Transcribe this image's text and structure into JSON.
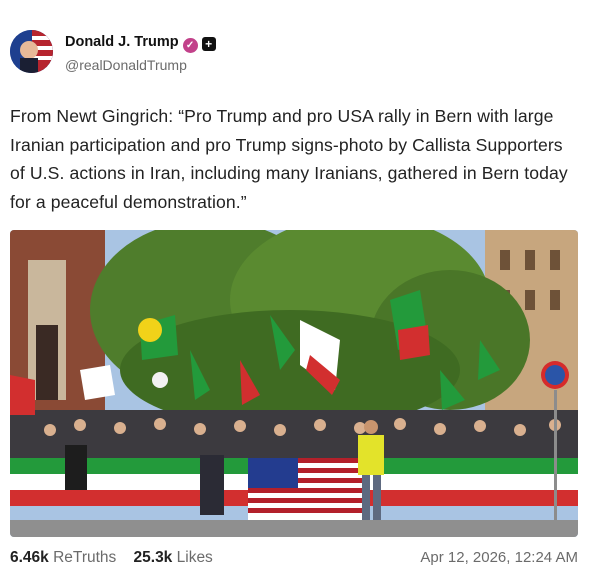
{
  "author": {
    "display_name": "Donald J. Trump",
    "handle": "@realDonaldTrump",
    "verified_icon": "verified-badge-icon",
    "extra_icon": "plus-square-icon"
  },
  "post": {
    "text": "From Newt Gingrich: “Pro Trump and pro USA rally in Bern with large Iranian participation and pro Trump signs-photo by Callista Supporters of U.S. actions in Iran, including many Iranians, gathered in Bern today for a peaceful demonstration.”"
  },
  "photo": {
    "subject": "rally-photo"
  },
  "stats": {
    "retruths_value": "6.46k",
    "retruths_label": "ReTruths",
    "likes_value": "25.3k",
    "likes_label": "Likes"
  },
  "timestamp": "Apr 12, 2026, 12:24 AM",
  "colors": {
    "verified_badge": "#c2418a",
    "text_primary": "#222222",
    "text_secondary": "#6b6b6b"
  }
}
